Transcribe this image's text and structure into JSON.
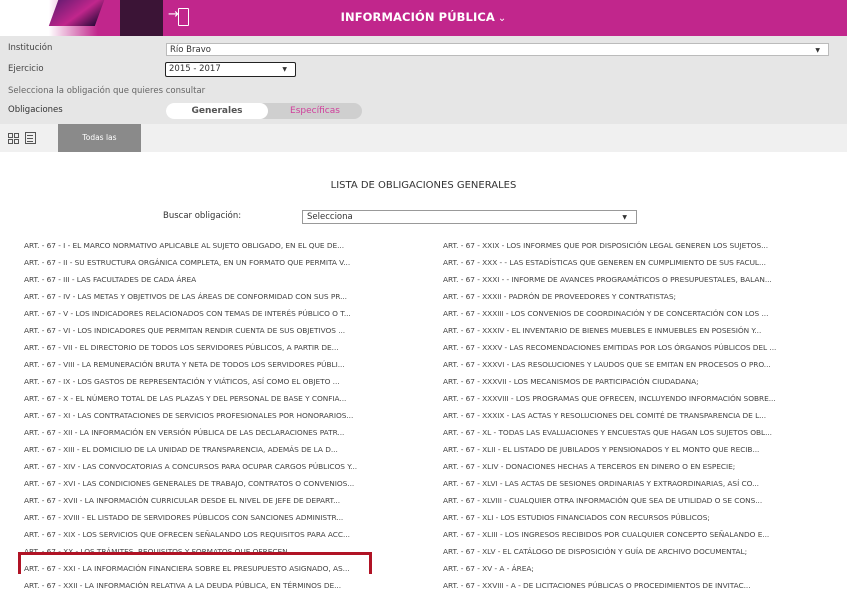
{
  "header": {
    "title": "INFORMACIÓN PÚBLICA",
    "chevron": "⌄"
  },
  "filters": {
    "institution_label": "Institución",
    "institution_value": "Río Bravo",
    "exercise_label": "Ejercicio",
    "exercise_value": "2015 - 2017",
    "select_prompt": "Selecciona la obligación que quieres consultar",
    "obligations_label": "Obligaciones",
    "toggle_general": "Generales",
    "toggle_specific": "Específicas"
  },
  "viewbar": {
    "all_label": "Todas las obligaciones"
  },
  "main": {
    "list_title": "LISTA DE OBLIGACIONES GENERALES",
    "search_label": "Buscar obligación:",
    "search_value": "Selecciona"
  },
  "left_items": [
    "ART. - 67 - I - EL MARCO NORMATIVO APLICABLE AL SUJETO OBLIGADO, EN EL QUE DE...",
    "ART. - 67 - II - SU ESTRUCTURA ORGÁNICA COMPLETA, EN UN FORMATO QUE PERMITA V...",
    "ART. - 67 - III - LAS FACULTADES DE CADA ÁREA",
    "ART. - 67 - IV - LAS METAS Y OBJETIVOS DE LAS ÁREAS DE CONFORMIDAD CON SUS PR...",
    "ART. - 67 - V - LOS INDICADORES RELACIONADOS CON TEMAS DE INTERÉS PÚBLICO O T...",
    "ART. - 67 - VI - LOS INDICADORES QUE PERMITAN RENDIR CUENTA DE SUS OBJETIVOS ...",
    "ART. - 67 - VII - EL DIRECTORIO DE TODOS LOS SERVIDORES PÚBLICOS, A PARTIR DE...",
    "ART. - 67 - VIII - LA REMUNERACIÓN BRUTA Y NETA DE TODOS LOS SERVIDORES PÚBLI...",
    "ART. - 67 - IX - LOS GASTOS DE REPRESENTACIÓN Y VIÁTICOS, ASÍ COMO EL OBJETO ...",
    "ART. - 67 - X - EL NÚMERO TOTAL DE LAS PLAZAS Y DEL PERSONAL DE BASE Y CONFIA...",
    "ART. - 67 - XI - LAS CONTRATACIONES DE SERVICIOS PROFESIONALES POR HONORARIOS...",
    "ART. - 67 - XII - LA INFORMACIÓN EN VERSIÓN PÚBLICA DE LAS DECLARACIONES PATR...",
    "ART. - 67 - XIII - EL DOMICILIO DE LA UNIDAD DE TRANSPARENCIA, ADEMÁS DE LA D...",
    "ART. - 67 - XIV - LAS CONVOCATORIAS A CONCURSOS PARA OCUPAR CARGOS PÚBLICOS Y...",
    "ART. - 67 - XVI - LAS CONDICIONES GENERALES DE TRABAJO, CONTRATOS O CONVENIOS...",
    "ART. - 67 - XVII - LA INFORMACIÓN CURRICULAR DESDE EL NIVEL DE JEFE DE DEPART...",
    "ART. - 67 - XVIII - EL LISTADO DE SERVIDORES PÚBLICOS CON SANCIONES ADMINISTR...",
    "ART. - 67 - XIX - LOS SERVICIOS QUE OFRECEN SEÑALANDO LOS REQUISITOS PARA ACC...",
    "ART. - 67 - XX - LOS TRÁMITES, REQUISITOS Y FORMATOS QUE OFRECEN",
    "ART. - 67 - XXI - LA INFORMACIÓN FINANCIERA SOBRE EL PRESUPUESTO ASIGNADO, AS...",
    "ART. - 67 - XXII - LA INFORMACIÓN RELATIVA A LA DEUDA PÚBLICA, EN TÉRMINOS DE..."
  ],
  "right_items": [
    "ART. - 67 - XXIX - LOS INFORMES QUE POR DISPOSICIÓN LEGAL GENEREN LOS SUJETOS...",
    "ART. - 67 - XXX - - LAS ESTADÍSTICAS QUE GENEREN EN CUMPLIMIENTO DE SUS FACUL...",
    "ART. - 67 - XXXI - - INFORME DE AVANCES PROGRAMÁTICOS O PRESUPUESTALES, BALAN...",
    "ART. - 67 - XXXII - PADRÓN DE PROVEEDORES Y CONTRATISTAS;",
    "ART. - 67 - XXXIII - LOS CONVENIOS DE COORDINACIÓN Y DE CONCERTACIÓN CON LOS ...",
    "ART. - 67 - XXXIV - EL INVENTARIO DE BIENES MUEBLES E INMUEBLES EN POSESIÓN Y...",
    "ART. - 67 - XXXV - LAS RECOMENDACIONES EMITIDAS POR LOS ÓRGANOS PÚBLICOS DEL ...",
    "ART. - 67 - XXXVI - LAS RESOLUCIONES Y LAUDOS QUE SE EMITAN EN PROCESOS O PRO...",
    "ART. - 67 - XXXVII - LOS MECANISMOS DE PARTICIPACIÓN CIUDADANA;",
    "ART. - 67 - XXXVIII - LOS PROGRAMAS QUE OFRECEN, INCLUYENDO INFORMACIÓN SOBRE...",
    "ART. - 67 - XXXIX - LAS ACTAS Y RESOLUCIONES DEL COMITÉ DE TRANSPARENCIA DE L...",
    "ART. - 67 - XL - TODAS LAS EVALUACIONES Y ENCUESTAS QUE HAGAN LOS SUJETOS OBL...",
    "ART. - 67 - XLII - EL LISTADO DE JUBILADOS Y PENSIONADOS Y EL MONTO QUE RECIB...",
    "ART. - 67 - XLIV - DONACIONES HECHAS A TERCEROS EN DINERO O EN ESPECIE;",
    "ART. - 67 - XLVI - LAS ACTAS DE SESIONES ORDINARIAS Y EXTRAORDINARIAS, ASÍ CO...",
    "ART. - 67 - XLVIII - CUALQUIER OTRA INFORMACIÓN QUE SEA DE UTILIDAD O SE CONS...",
    "ART. - 67 - XLI - LOS ESTUDIOS FINANCIADOS CON RECURSOS PÚBLICOS;",
    "ART. - 67 - XLIII - LOS INGRESOS RECIBIDOS POR CUALQUIER CONCEPTO SEÑALANDO E...",
    "ART. - 67 - XLV - EL CATÁLOGO DE DISPOSICIÓN Y GUÍA DE ARCHIVO DOCUMENTAL;",
    "ART. - 67 - XV - A - ÁREA;",
    "ART. - 67 - XXVIII - A - DE LICITACIONES PÚBLICAS O PROCEDIMIENTOS DE INVITAC..."
  ]
}
